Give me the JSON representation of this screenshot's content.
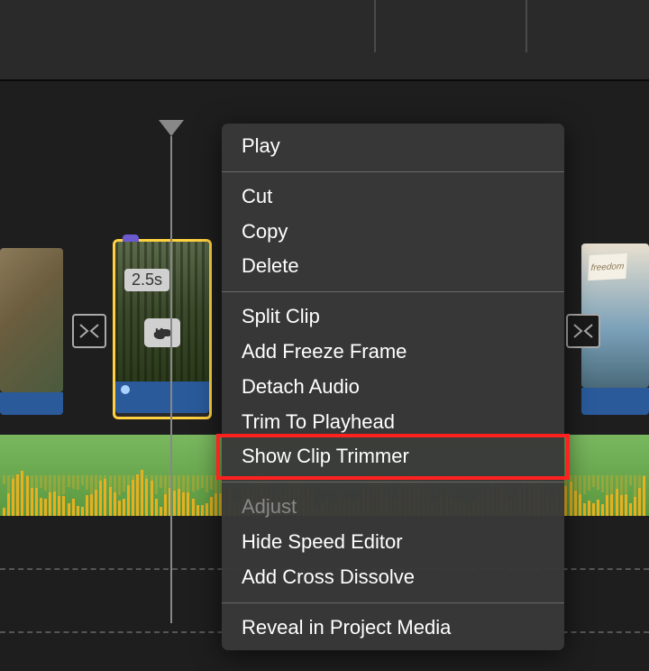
{
  "clip": {
    "duration": "2.5s",
    "flag_text": "freedom"
  },
  "menu": {
    "play": "Play",
    "cut": "Cut",
    "copy": "Copy",
    "delete": "Delete",
    "split_clip": "Split Clip",
    "add_freeze_frame": "Add Freeze Frame",
    "detach_audio": "Detach Audio",
    "trim_to_playhead": "Trim To Playhead",
    "show_clip_trimmer": "Show Clip Trimmer",
    "adjust": "Adjust",
    "hide_speed_editor": "Hide Speed Editor",
    "add_cross_dissolve": "Add Cross Dissolve",
    "reveal_in_project_media": "Reveal in Project Media"
  },
  "icons": {
    "rabbit": "🐇"
  },
  "highlight": {
    "target": "show_clip_trimmer"
  }
}
